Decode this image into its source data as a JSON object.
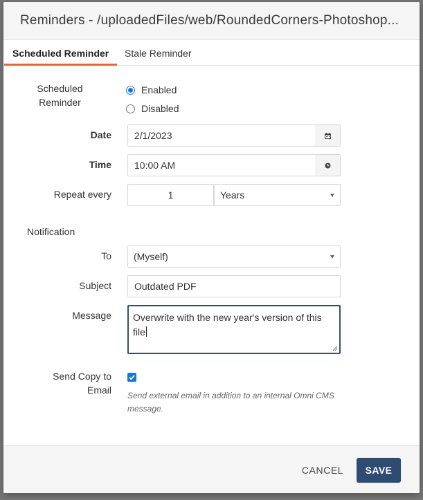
{
  "modal": {
    "title": "Reminders - /uploadedFiles/web/RoundedCorners-Photoshop..."
  },
  "tabs": [
    {
      "label": "Scheduled Reminder",
      "active": true
    },
    {
      "label": "Stale Reminder",
      "active": false
    }
  ],
  "schedule": {
    "label_line1": "Scheduled",
    "label_line2": "Reminder",
    "options": [
      {
        "label": "Enabled",
        "checked": true
      },
      {
        "label": "Disabled",
        "checked": false
      }
    ]
  },
  "date": {
    "label": "Date",
    "value": "2/1/2023",
    "icon": "calendar-icon"
  },
  "time": {
    "label": "Time",
    "value": "10:00 AM",
    "icon": "clock-icon"
  },
  "repeat": {
    "label": "Repeat every",
    "count": "1",
    "unit": "Years"
  },
  "notification": {
    "section_label": "Notification",
    "to": {
      "label": "To",
      "value": "(Myself)"
    },
    "subject": {
      "label": "Subject",
      "value": "Outdated PDF"
    },
    "message": {
      "label": "Message",
      "value": "Overwrite with the new year's version of this file"
    },
    "send_copy": {
      "label_line1": "Send Copy to",
      "label_line2": "Email",
      "checked": true,
      "help": "Send external email in addition to an internal Omni CMS message."
    }
  },
  "footer": {
    "cancel_label": "CANCEL",
    "save_label": "SAVE"
  },
  "colors": {
    "accent_tab": "#e8633a",
    "primary_button": "#2f4b72",
    "radio_checkbox": "#1976d2"
  }
}
